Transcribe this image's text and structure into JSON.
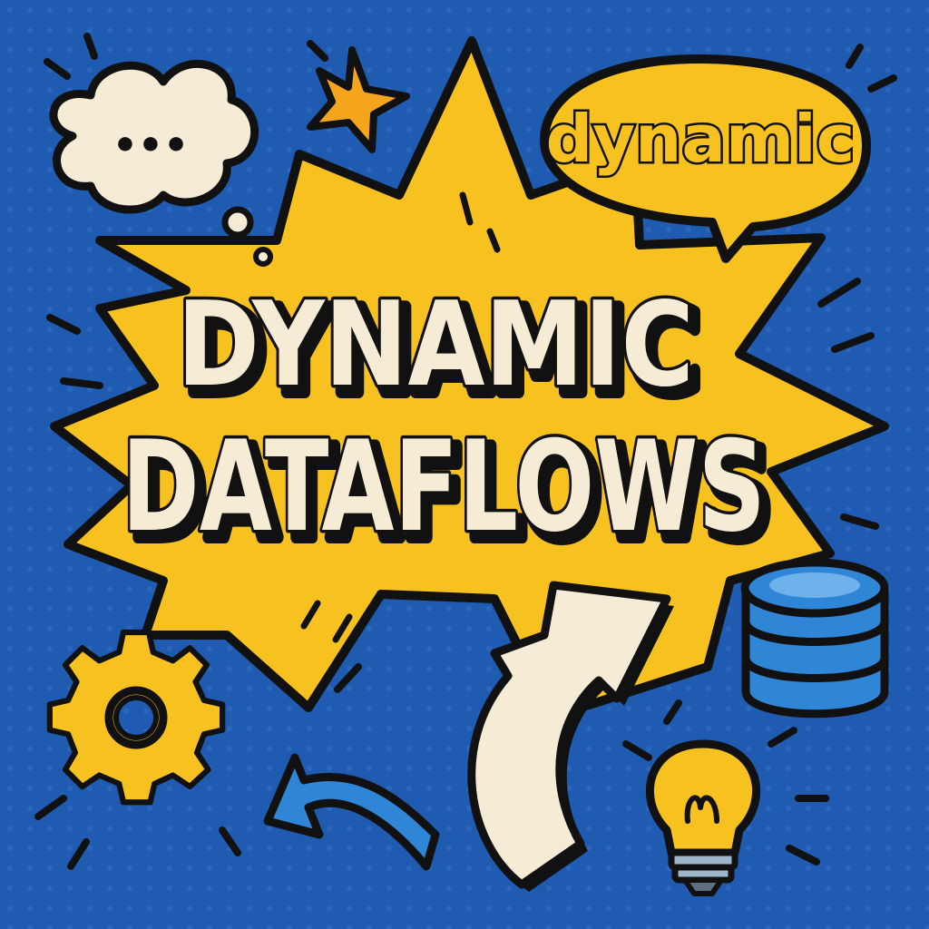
{
  "title": {
    "line1": "DYNAMIC",
    "line2": "DATAFLOWS"
  },
  "speech_bubble": {
    "text": "dynamic"
  },
  "thought_bubble": {
    "text": "•••"
  },
  "colors": {
    "background": "#1f5bb0",
    "background_dots": "#2a67bd",
    "burst": "#f7c21f",
    "outline": "#111111",
    "cream": "#f6ecd6",
    "accent_blue": "#2f86d6",
    "star_orange": "#f4a51c"
  },
  "icons": [
    "thought-bubble-icon",
    "sparkle-star-icon",
    "speech-bubble-icon",
    "gear-icon",
    "database-icon",
    "curved-arrow-up-icon",
    "curved-arrow-left-icon",
    "lightbulb-icon"
  ]
}
